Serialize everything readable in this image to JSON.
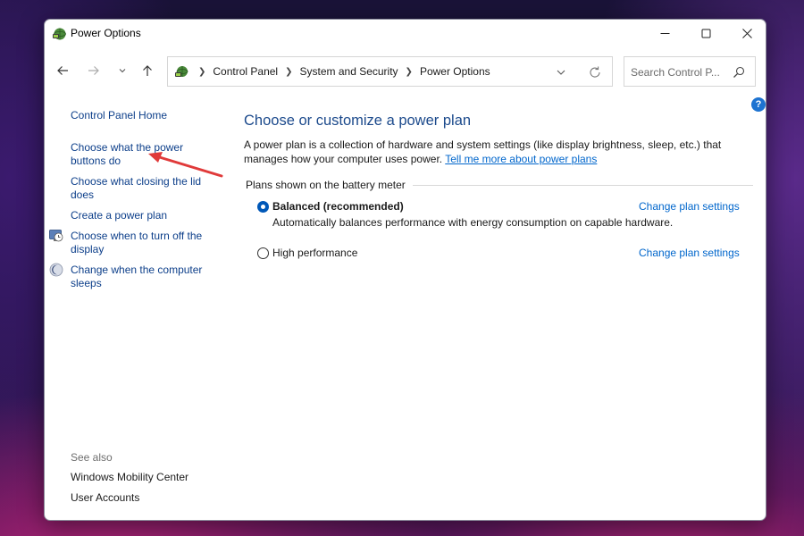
{
  "window": {
    "title": "Power Options",
    "controls": [
      "minimize",
      "maximize",
      "close"
    ]
  },
  "nav": {
    "breadcrumbs": [
      "Control Panel",
      "System and Security",
      "Power Options"
    ],
    "search_placeholder": "Search Control P..."
  },
  "sidebar": {
    "home": "Control Panel Home",
    "links": [
      {
        "label": "Choose what the power buttons do",
        "icon": null
      },
      {
        "label": "Choose what closing the lid does",
        "icon": null
      },
      {
        "label": "Create a power plan",
        "icon": null
      },
      {
        "label": "Choose when to turn off the display",
        "icon": "monitor-clock-icon"
      },
      {
        "label": "Change when the computer sleeps",
        "icon": "moon-sleep-icon"
      }
    ],
    "see_also_title": "See also",
    "see_also": [
      "Windows Mobility Center",
      "User Accounts"
    ]
  },
  "main": {
    "title": "Choose or customize a power plan",
    "description": "A power plan is a collection of hardware and system settings (like display brightness, sleep, etc.) that manages how your computer uses power.",
    "description_link": "Tell me more about power plans",
    "group_label": "Plans shown on the battery meter",
    "plans": [
      {
        "name": "Balanced (recommended)",
        "selected": true,
        "description": "Automatically balances performance with energy consumption on capable hardware.",
        "link": "Change plan settings"
      },
      {
        "name": "High performance",
        "selected": false,
        "description": "",
        "link": "Change plan settings"
      }
    ]
  },
  "colors": {
    "link": "#0066cc",
    "title": "#1c4a8c",
    "sidebar_link": "#0d3f8a",
    "annotation_arrow": "#e03a3a"
  }
}
